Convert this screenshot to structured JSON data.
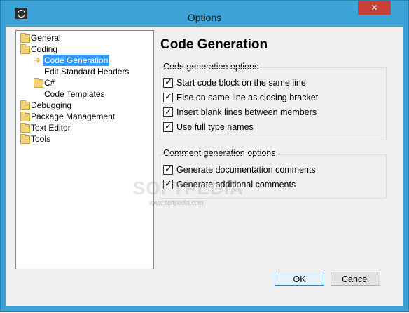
{
  "window": {
    "title": "Options",
    "close_glyph": "✕",
    "app_icon": "sharpdevelop-app-icon"
  },
  "tree": {
    "items": [
      {
        "label": "General",
        "icon": "folder-icon"
      },
      {
        "label": "Coding",
        "icon": "folder-icon"
      },
      {
        "label": "Code Generation",
        "icon": "arrow-icon",
        "selected": true
      },
      {
        "label": "Edit Standard Headers",
        "icon": ""
      },
      {
        "label": "C#",
        "icon": "folder-icon"
      },
      {
        "label": "Code Templates",
        "icon": ""
      },
      {
        "label": "Debugging",
        "icon": "folder-icon"
      },
      {
        "label": "Package Management",
        "icon": "folder-icon"
      },
      {
        "label": "Text Editor",
        "icon": "folder-icon"
      },
      {
        "label": "Tools",
        "icon": "folder-icon"
      }
    ],
    "arrow_glyph": "➜"
  },
  "panel": {
    "title": "Code Generation",
    "code_group": {
      "label": "Code generation options",
      "options": [
        {
          "label": "Start code block on the same line",
          "checked": true
        },
        {
          "label": "Else on same line as closing bracket",
          "checked": true
        },
        {
          "label": "Insert blank lines between members",
          "checked": true
        },
        {
          "label": "Use full type names",
          "checked": true
        }
      ]
    },
    "comment_group": {
      "label": "Comment generation options",
      "options": [
        {
          "label": "Generate documentation comments",
          "checked": true
        },
        {
          "label": "Generate additional comments",
          "checked": true
        }
      ]
    },
    "check_glyph": "✓"
  },
  "buttons": {
    "ok": "OK",
    "cancel": "Cancel"
  },
  "watermark": {
    "text": "SOFTPEDIA",
    "url": "www.softpedia.com"
  }
}
